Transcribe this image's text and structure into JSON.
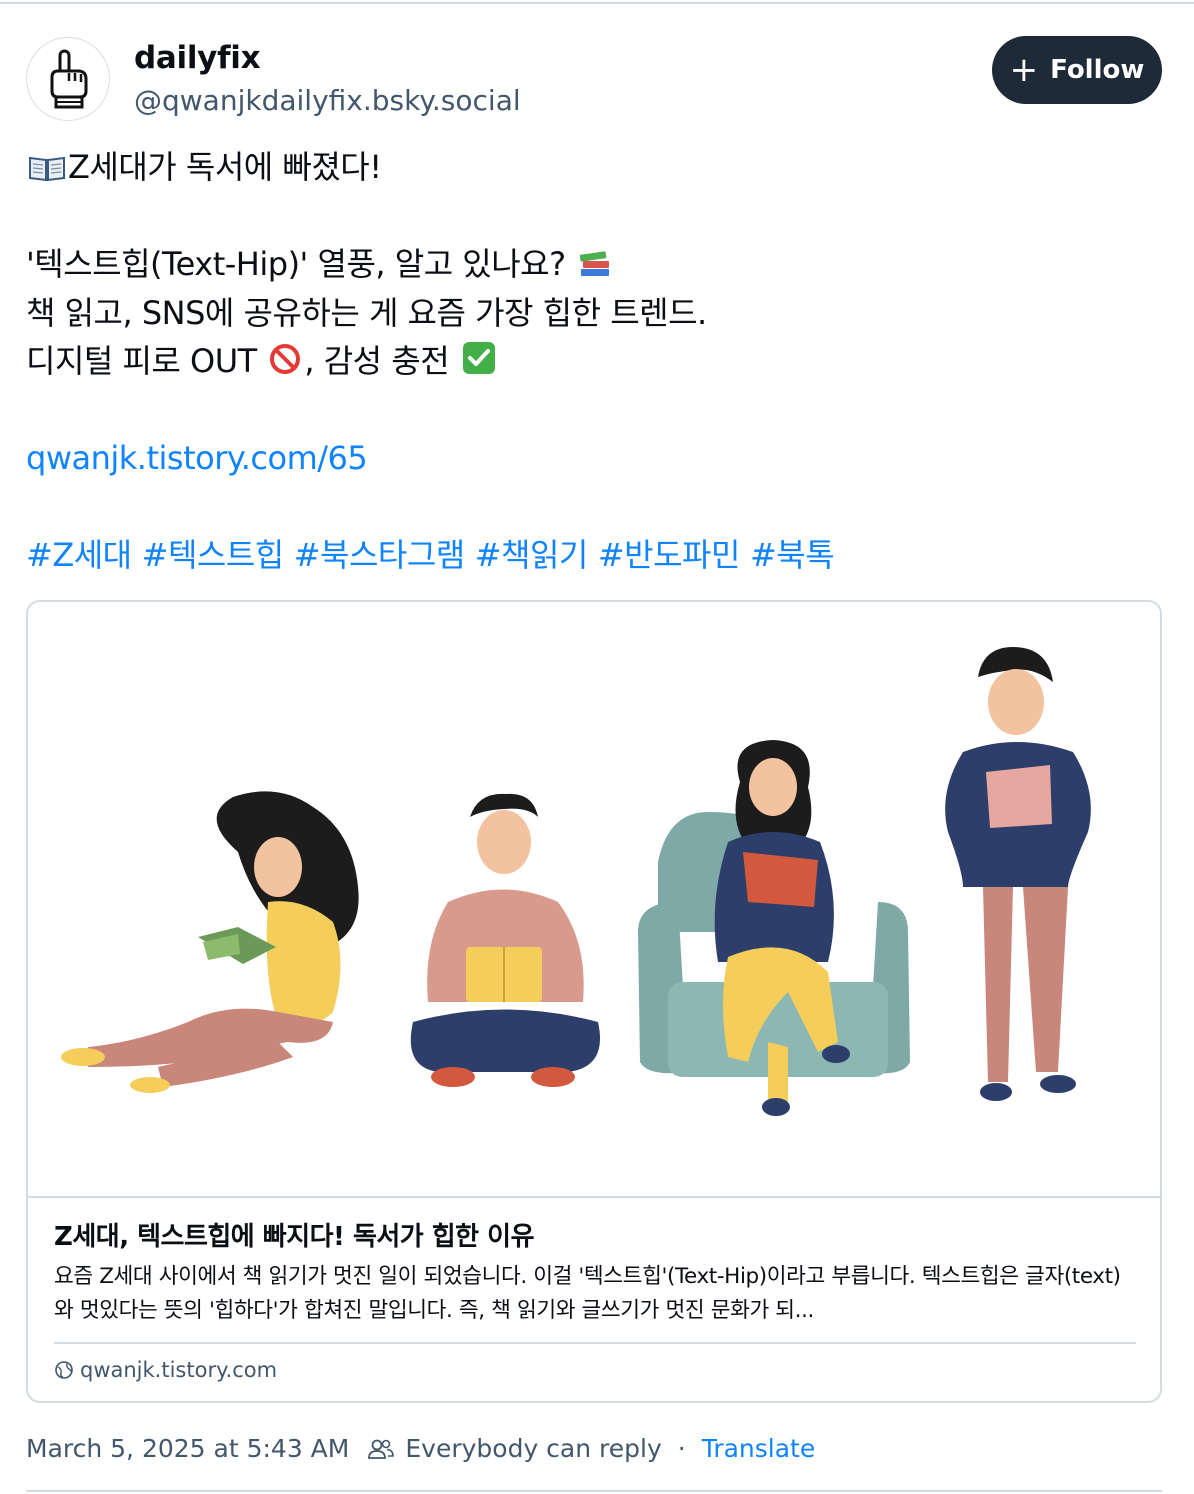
{
  "author": {
    "display_name": "dailyfix",
    "handle": "@qwanjkdailyfix.bsky.social",
    "avatar_icon": "pointing-hand-icon"
  },
  "follow_button": {
    "label": "Follow",
    "icon": "plus-icon"
  },
  "post": {
    "line1": "Z세대가 독서에 빠졌다!",
    "line2": "'텍스트힙(Text-Hip)' 열풍, 알고 있나요?",
    "line3": "책 읽고, SNS에 공유하는 게 요즘 가장 힙한 트렌드.",
    "line4a": "디지털 피로 OUT",
    "line4b": ", 감성 충전",
    "link": "qwanjk.tistory.com/65",
    "hashtags": [
      "#Z세대",
      "#텍스트힙",
      "#북스타그램",
      "#책읽기",
      "#반도파민",
      "#북톡"
    ],
    "emoji_icons": [
      "open-book-icon",
      "books-icon",
      "no-entry-icon",
      "check-mark-icon"
    ]
  },
  "link_card": {
    "title": "Z세대, 텍스트힙에 빠지다! 독서가 힙한 이유",
    "description": "요즘 Z세대 사이에서 책 읽기가 멋진 일이 되었습니다. 이걸 '텍스트힙'(Text-Hip)이라고 부릅니다. 텍스트힙은 글자(text)와 멋있다는 뜻의 '힙하다'가 합쳐진 말입니다. 즉, 책 읽기와 글쓰기가 멋진 문화가 되...",
    "domain": "qwanjk.tistory.com",
    "image": "illustration-four-people-reading-books"
  },
  "footer": {
    "timestamp": "March 5, 2025 at 5:43 AM",
    "reply_setting": "Everybody can reply",
    "separator": "·",
    "translate": "Translate"
  },
  "colors": {
    "link": "#1083fe",
    "follow_bg": "#1e2a37",
    "muted": "#42576c",
    "border": "#d4dbe2"
  }
}
